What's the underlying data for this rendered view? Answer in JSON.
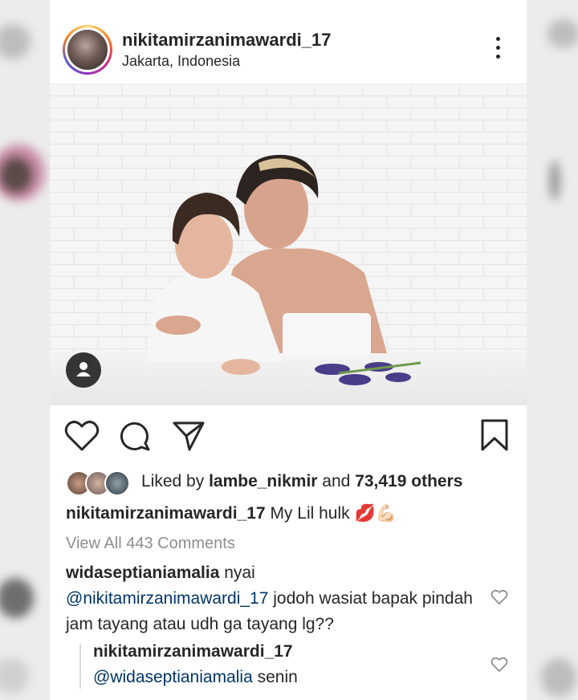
{
  "post": {
    "username": "nikitamirzanimawardi_17",
    "location": "Jakarta, Indonesia"
  },
  "likes": {
    "prefix": "Liked by ",
    "liker": "lambe_nikmir",
    "middle": " and ",
    "count": "73,419 others"
  },
  "caption": {
    "username": "nikitamirzanimawardi_17",
    "text": " My Lil hulk 💋💪🏻"
  },
  "view_all_comments": "View All 443 Comments",
  "comments": [
    {
      "username": "widaseptianiamalia",
      "text_before": " nyai",
      "mention": "@nikitamirzanimawardi_17",
      "text_after": " jodoh wasiat bapak pindah jam tayang atau udh ga tayang lg??"
    }
  ],
  "reply": {
    "username": "nikitamirzanimawardi_17",
    "mention": "@widaseptianiamalia",
    "text": " senin"
  },
  "icons": [
    "more-icon",
    "user-tag-icon",
    "heart-icon",
    "comment-icon",
    "share-icon",
    "bookmark-icon"
  ],
  "colors": {
    "text": "#262626",
    "muted": "#8e8e8e",
    "mention": "#003569",
    "background": "#ffffff"
  }
}
